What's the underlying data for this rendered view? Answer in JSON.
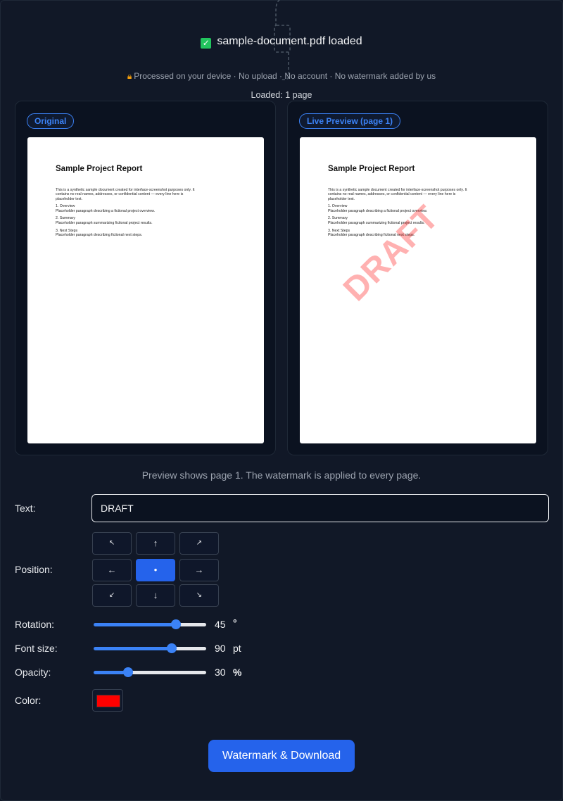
{
  "status": {
    "file_loaded": "sample-document.pdf loaded",
    "privacy_note": "Processed on your device · No upload · No account · No watermark added by us",
    "pages_loaded": "Loaded: 1 page"
  },
  "original_panel": {
    "label": "Original"
  },
  "preview_panel": {
    "label": "Live Preview (page 1)"
  },
  "document": {
    "title": "Sample Project Report",
    "intro": "This is a synthetic sample document created for interface-screenshot purposes only. It contains no real names, addresses, or confidential content — every line here is placeholder text.",
    "sections": [
      {
        "heading": "1. Overview",
        "text": "Placeholder paragraph describing a fictional project overview."
      },
      {
        "heading": "2. Summary",
        "text": "Placeholder paragraph summarizing fictional project results."
      },
      {
        "heading": "3. Next Steps",
        "text": "Placeholder paragraph describing fictional next steps."
      }
    ]
  },
  "preview_note": "Preview shows page 1. The watermark is applied to every page.",
  "form": {
    "text_label": "Text:",
    "text_value": "DRAFT",
    "position_label": "Position:",
    "position_buttons": [
      "↖",
      "↑",
      "↗",
      "←",
      "•",
      "→",
      "↙",
      "↓",
      "↘"
    ],
    "position_selected": "center",
    "rotation_label": "Rotation:",
    "rotation_value": "45",
    "rotation_unit": "°",
    "rotation_fraction": 0.75,
    "font_size_label": "Font size:",
    "font_size_value": "90",
    "font_size_unit": "pt",
    "font_size_fraction": 0.71,
    "opacity_label": "Opacity:",
    "opacity_value": "30",
    "opacity_unit": "%",
    "opacity_fraction": 0.29,
    "color_label": "Color:",
    "color_value": "#ff0000"
  },
  "actions": {
    "download_label": "Watermark & Download"
  },
  "colors": {
    "accent": "#2563eb",
    "background": "#111827",
    "success": "#22c55e"
  }
}
